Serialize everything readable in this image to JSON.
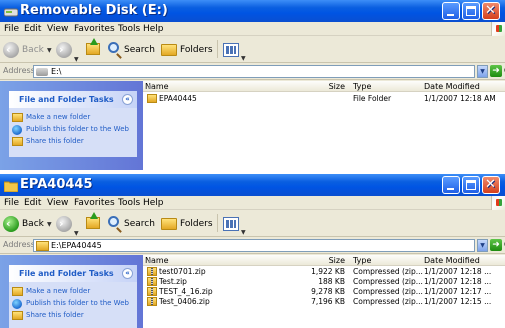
{
  "windows": [
    {
      "title": "Removable Disk (E:)",
      "menu": [
        "File",
        "Edit",
        "View",
        "Favorites",
        "Tools",
        "Help"
      ],
      "toolbar": {
        "back": "Back",
        "search": "Search",
        "folders": "Folders"
      },
      "address": {
        "label": "Address",
        "value": "E:\\",
        "go": "Go"
      },
      "tasks": {
        "header": "File and Folder Tasks",
        "items": [
          "Make a new folder",
          "Publish this folder to the Web",
          "Share this folder"
        ]
      },
      "columns": {
        "name": "Name",
        "size": "Size",
        "type": "Type",
        "date": "Date Modified"
      },
      "files": [
        {
          "name": "EPA40445",
          "size": "",
          "type": "File Folder",
          "date": "1/1/2007 12:18 AM"
        }
      ]
    },
    {
      "title": "EPA40445",
      "menu": [
        "File",
        "Edit",
        "View",
        "Favorites",
        "Tools",
        "Help"
      ],
      "toolbar": {
        "back": "Back",
        "search": "Search",
        "folders": "Folders"
      },
      "address": {
        "label": "Address",
        "value": "E:\\EPA40445",
        "go": "Go"
      },
      "tasks": {
        "header": "File and Folder Tasks",
        "items": [
          "Make a new folder",
          "Publish this folder to the Web",
          "Share this folder"
        ]
      },
      "columns": {
        "name": "Name",
        "size": "Size",
        "type": "Type",
        "date": "Date Modified"
      },
      "files": [
        {
          "name": "test0701.zip",
          "size": "1,922 KB",
          "type": "Compressed (zip...",
          "date": "1/1/2007 12:18 ..."
        },
        {
          "name": "Test.zip",
          "size": "188 KB",
          "type": "Compressed (zip...",
          "date": "1/1/2007 12:18 ..."
        },
        {
          "name": "TEST_4_16.zip",
          "size": "9,278 KB",
          "type": "Compressed (zip...",
          "date": "1/1/2007 12:17 ..."
        },
        {
          "name": "Test_0406.zip",
          "size": "7,196 KB",
          "type": "Compressed (zip...",
          "date": "1/1/2007 12:15 ..."
        }
      ]
    }
  ],
  "colors": {
    "titlebar": "#0054e3",
    "taskpane": "#6375d6",
    "tasklink": "#215dc6",
    "window": "#ece9d8"
  },
  "icons": [
    "drive-icon",
    "folder-icon",
    "back-icon",
    "forward-icon",
    "up-folder-icon",
    "search-icon",
    "folders-icon",
    "views-icon",
    "go-icon",
    "zip-file-icon",
    "new-folder-icon",
    "publish-web-icon",
    "share-folder-icon"
  ]
}
